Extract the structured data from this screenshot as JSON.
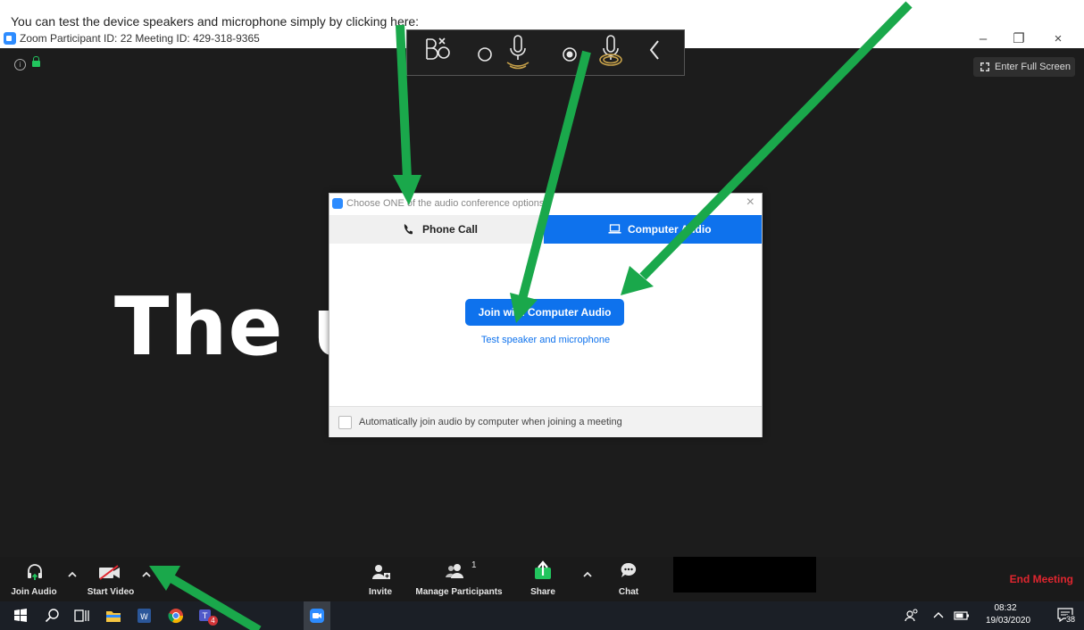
{
  "doc": {
    "line1": "",
    "line2": "You can test the device speakers and microphone    simply by clicking here:"
  },
  "window": {
    "title": "Zoom Participant ID: 22   Meeting ID: 429-318-9365",
    "minimize": "–",
    "restore": "❐",
    "close": "×"
  },
  "stage": {
    "fullscreen_label": "Enter Full Screen",
    "info_glyph": "i",
    "big_title": "The           ur…"
  },
  "dialog": {
    "title": "Choose ONE of the audio conference options",
    "close": "×",
    "tabs": [
      {
        "label": "Phone Call",
        "icon": "phone-icon"
      },
      {
        "label": "Computer Audio",
        "icon": "laptop-icon"
      }
    ],
    "join_button": "Join with Computer Audio",
    "test_link": "Test speaker and microphone",
    "checkbox_label": "Automatically join audio by computer when joining a meeting"
  },
  "meeting_controls": {
    "join_audio": "Join Audio",
    "start_video": "Start Video",
    "invite": "Invite",
    "manage_participants": "Manage Participants",
    "participant_count": "1",
    "share": "Share",
    "chat": "Chat",
    "end_meeting": "End Meeting"
  },
  "taskbar": {
    "time": "08:32",
    "date": "19/03/2020",
    "notification_count": "38",
    "teams_badge": "4"
  },
  "colors": {
    "zoom_blue": "#0e72ed",
    "stage_bg": "#1c1c1c",
    "end_red": "#e0262f",
    "arrow_green": "#1aa84b",
    "share_green": "#22c55e"
  }
}
